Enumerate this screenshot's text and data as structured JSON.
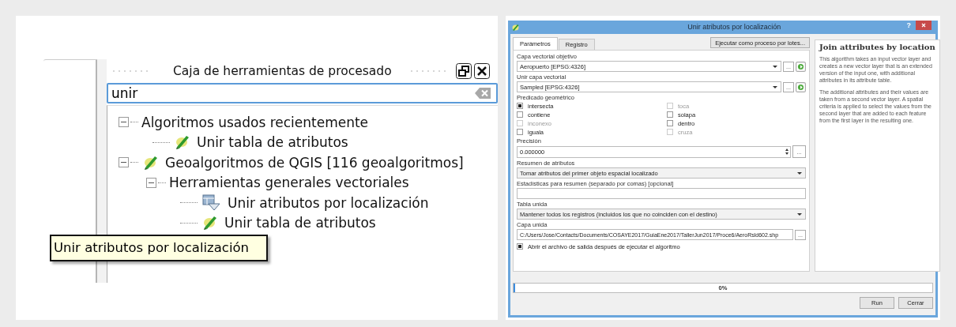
{
  "toolbox": {
    "title": "Caja de herramientas de procesado",
    "search": {
      "value": "unir"
    },
    "tree": [
      {
        "label": "Algoritmos usados recientemente",
        "kind": "group",
        "expanded": true,
        "children": [
          {
            "label": "Unir tabla de atributos",
            "kind": "algorithm"
          }
        ]
      },
      {
        "label": "Geoalgoritmos de QGIS [116 geoalgoritmos]",
        "kind": "provider",
        "expanded": true,
        "children": [
          {
            "label": "Herramientas generales vectoriales",
            "kind": "group",
            "expanded": true,
            "children": [
              {
                "label": "Unir atributos por localización",
                "kind": "vector-algorithm"
              },
              {
                "label": "Unir tabla de atributos",
                "kind": "algorithm"
              }
            ]
          }
        ]
      }
    ],
    "tooltip": "Unir atributos por localización"
  },
  "dialog": {
    "title": "Unir atributos por localización",
    "help_button": "?",
    "tabs": [
      {
        "label": "Parámetros",
        "selected": true
      },
      {
        "label": "Registro",
        "selected": false
      }
    ],
    "batch_button": "Ejecutar como proceso por lotes...",
    "params": [
      {
        "kind": "layer",
        "label": "Capa vectorial objetivo",
        "value": "Aeropuerto [EPSG:4326]",
        "button": "..."
      },
      {
        "kind": "layer",
        "label": "Unir capa vectorial",
        "value": "Sampled [EPSG:4326]",
        "button": "..."
      },
      {
        "kind": "checks",
        "label": "Predicado geométrico",
        "options": [
          {
            "label": "intersecta",
            "checked": true,
            "disabled": false
          },
          {
            "label": "toca",
            "checked": false,
            "disabled": true
          },
          {
            "label": "contiene",
            "checked": false,
            "disabled": false
          },
          {
            "label": "solapa",
            "checked": false,
            "disabled": false
          },
          {
            "label": "inconexo",
            "checked": false,
            "disabled": true
          },
          {
            "label": "dentro",
            "checked": false,
            "disabled": false
          },
          {
            "label": "iguala",
            "checked": false,
            "disabled": false
          },
          {
            "label": "cruza",
            "checked": false,
            "disabled": true
          }
        ]
      },
      {
        "kind": "number",
        "label": "Precisión",
        "value": "0.000000",
        "button": "..."
      },
      {
        "kind": "combo",
        "label": "Resumen de atributos",
        "value": "Tomar atributos del primer objeto espacial localizado"
      },
      {
        "kind": "text",
        "label": "Estadísticas para resumen (separado por comas) [opcional]"
      },
      {
        "kind": "combo",
        "label": "Tabla unida",
        "value": "Mantener todos los registros (incluidos los que no coinciden con el destino)"
      },
      {
        "kind": "file",
        "label": "Capa unida",
        "value": "C:/Users/Jose/Contacts/Documents/COSAYE2017/GuiaEne2017/TallerJun2017/Proce6/AeroRsld602.shp",
        "button": "..."
      },
      {
        "kind": "checkbox",
        "label": "Abrir el archivo de salida después de ejecutar el algoritmo",
        "checked": true
      }
    ],
    "help": {
      "title": "Join attributes by location",
      "paragraphs": [
        "This algorithm takes an input vector layer and creates a new vector layer that is an extended version of the input one, with additional attributes in its attribute table.",
        "The additional attributes and their values are taken from a second vector layer. A spatial criteria is applied to select the values from the second layer that are added to each feature from the first layer in the resulting one."
      ]
    },
    "progress": {
      "level": 0,
      "text": "0%"
    },
    "buttons": [
      "Run",
      "Cerrar"
    ]
  }
}
